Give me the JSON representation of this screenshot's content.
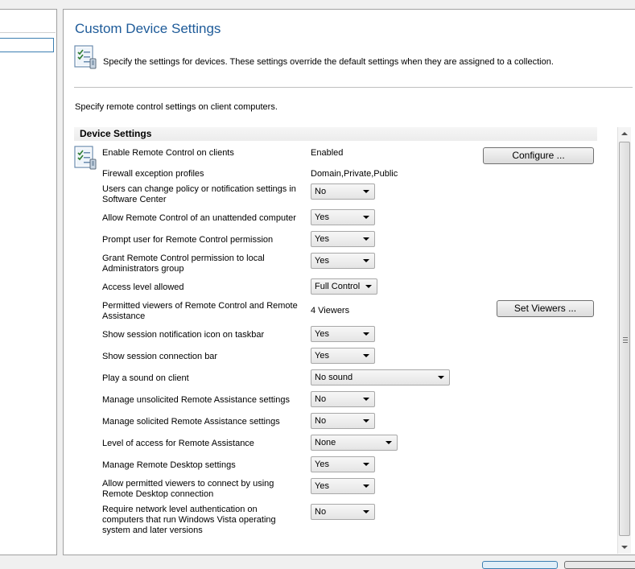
{
  "page": {
    "title": "Custom Device Settings",
    "description": "Specify the settings for devices. These settings override the default settings when they are assigned to a collection.",
    "intro": "Specify remote control settings on client computers.",
    "section_title": "Device Settings"
  },
  "rows": {
    "enable_remote_control": {
      "label": "Enable Remote Control on clients",
      "value": "Enabled",
      "button": "Configure ..."
    },
    "firewall_profiles": {
      "label": "Firewall exception profiles",
      "value": "Domain,Private,Public"
    },
    "users_change_policy": {
      "label": "Users can change policy or notification settings in Software Center",
      "value": "No"
    },
    "unattended": {
      "label": "Allow Remote Control of an unattended computer",
      "value": "Yes"
    },
    "prompt_permission": {
      "label": "Prompt user for Remote Control permission",
      "value": "Yes"
    },
    "grant_admins": {
      "label": "Grant Remote Control permission to local Administrators group",
      "value": "Yes"
    },
    "access_level": {
      "label": "Access level allowed",
      "value": "Full Control"
    },
    "permitted_viewers": {
      "label": "Permitted viewers of Remote Control and Remote Assistance",
      "value": "4 Viewers",
      "button": "Set Viewers ..."
    },
    "notification_icon": {
      "label": "Show session notification icon on taskbar",
      "value": "Yes"
    },
    "connection_bar": {
      "label": "Show session connection bar",
      "value": "Yes"
    },
    "play_sound": {
      "label": "Play a sound on client",
      "value": "No sound"
    },
    "unsolicited_ra": {
      "label": "Manage unsolicited Remote Assistance settings",
      "value": "No"
    },
    "solicited_ra": {
      "label": "Manage solicited Remote Assistance settings",
      "value": "No"
    },
    "ra_access_level": {
      "label": "Level of access for Remote Assistance",
      "value": "None"
    },
    "remote_desktop": {
      "label": "Manage Remote Desktop settings",
      "value": "Yes"
    },
    "viewers_rdp": {
      "label": "Allow permitted viewers to connect by using Remote Desktop connection",
      "value": "Yes"
    },
    "nla": {
      "label": "Require network level authentication on computers that run Windows Vista operating system and later versions",
      "value": "No"
    }
  }
}
